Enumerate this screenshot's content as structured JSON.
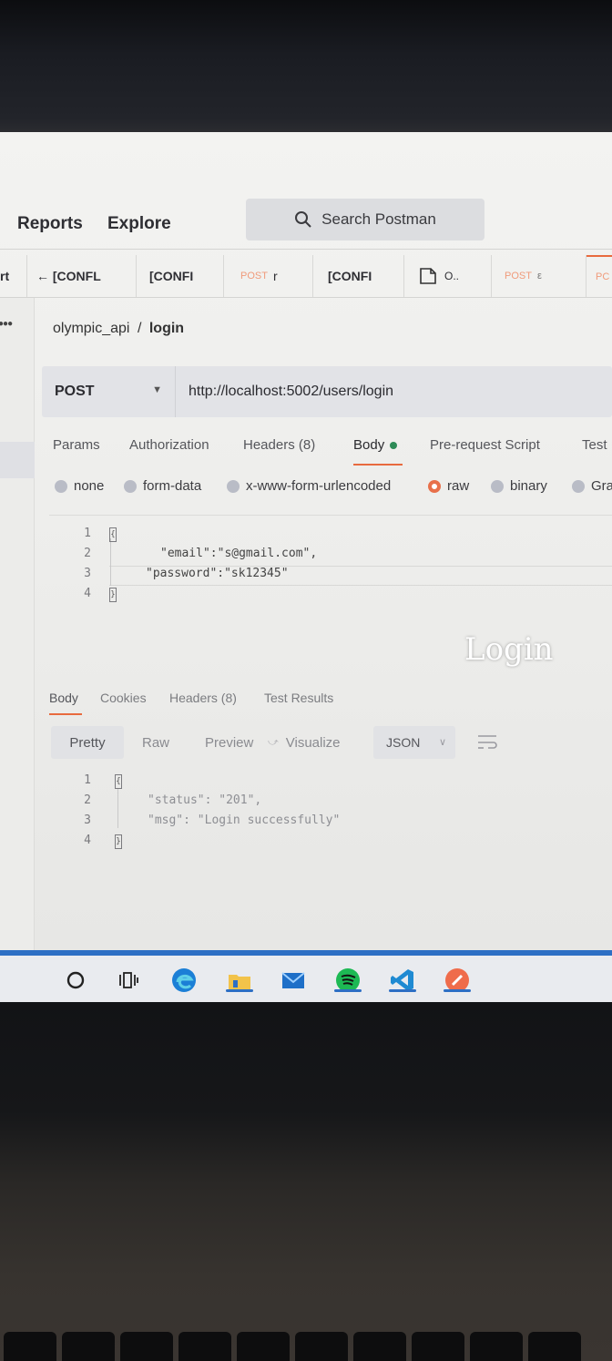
{
  "header": {
    "links": [
      "Reports",
      "Explore"
    ],
    "search_label": "Search Postman"
  },
  "tabs": [
    {
      "method": "",
      "label": "rt"
    },
    {
      "method": "",
      "label": "← [CONFL"
    },
    {
      "method": "",
      "label": "[CONFI"
    },
    {
      "method": "POST",
      "label": "r"
    },
    {
      "method": "",
      "label": "[CONFI"
    },
    {
      "method": "",
      "label": "O.."
    },
    {
      "method": "POST",
      "label": "ε"
    },
    {
      "method": "PC",
      "label": ""
    }
  ],
  "breadcrumb": {
    "collection": "olympic_api",
    "separator": "/",
    "request": "login"
  },
  "request": {
    "method": "POST",
    "url": "http://localhost:5002/users/login"
  },
  "request_tabs": [
    "Params",
    "Authorization",
    "Headers (8)",
    "Body",
    "Pre-request Script",
    "Test"
  ],
  "body_types": [
    {
      "label": "none",
      "selected": false
    },
    {
      "label": "form-data",
      "selected": false
    },
    {
      "label": "x-www-form-urlencoded",
      "selected": false
    },
    {
      "label": "raw",
      "selected": true
    },
    {
      "label": "binary",
      "selected": false
    },
    {
      "label": "Gra",
      "selected": false
    }
  ],
  "request_body": {
    "line_numbers": [
      "1",
      "2",
      "3",
      "4"
    ],
    "lines": [
      "{",
      "\"email\":\"s@gmail.com\",",
      "\"password\":\"sk12345\"",
      "}"
    ]
  },
  "watermark": "Login",
  "response_tabs": [
    "Body",
    "Cookies",
    "Headers (8)",
    "Test Results"
  ],
  "response_toolbar": {
    "views": [
      "Pretty",
      "Raw",
      "Preview",
      "Visualize"
    ],
    "format": "JSON"
  },
  "response_body": {
    "line_numbers": [
      "1",
      "2",
      "3",
      "4"
    ],
    "lines": [
      "{",
      "\"status\": \"201\",",
      "\"msg\": \"Login successfully\"",
      "}"
    ]
  },
  "colors": {
    "accent": "#e86a3e",
    "taskbar": "#2d6fc4",
    "body_dot": "#2e8b57"
  },
  "taskbar_icons": [
    "search-icon",
    "task-view-icon",
    "edge-icon",
    "file-explorer-icon",
    "mail-icon",
    "spotify-icon",
    "vscode-icon",
    "postman-icon"
  ]
}
